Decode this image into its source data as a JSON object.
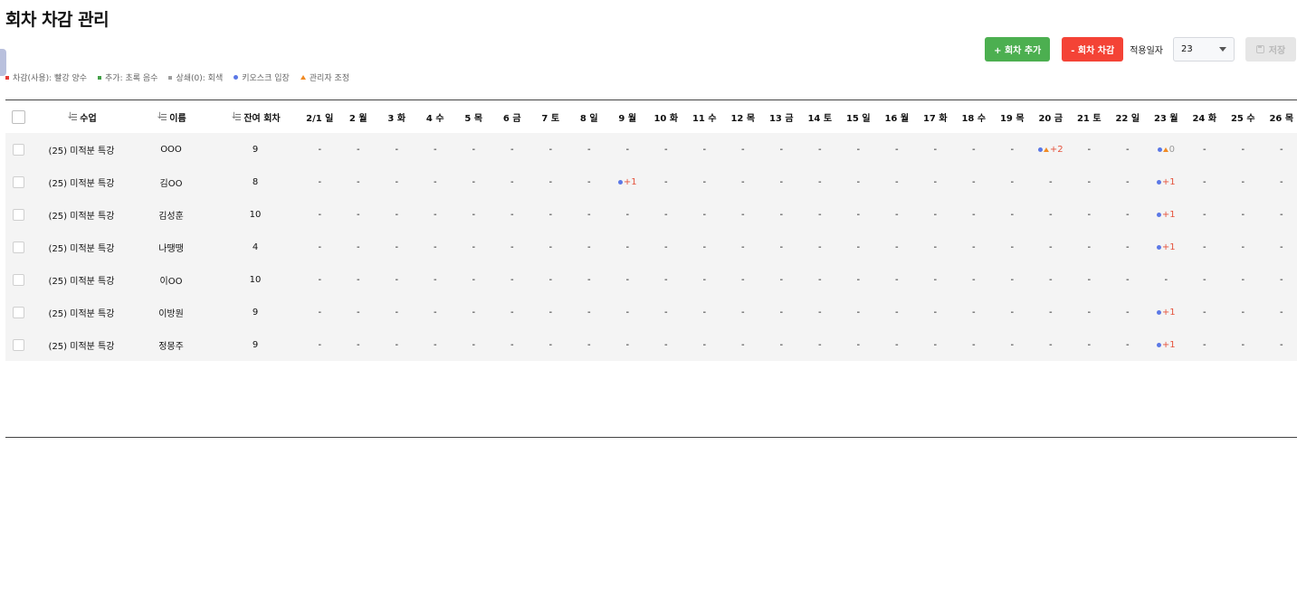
{
  "page": {
    "title": "회차 차감 관리"
  },
  "toolbar": {
    "add_label": "+ 회차 추가",
    "deduct_label": "- 회차 차감",
    "apply_date_label": "적용일자",
    "apply_date_value": "23",
    "save_label": "저장"
  },
  "legend": [
    {
      "label": "차감(사용): 빨강 양수",
      "shape": "square",
      "color": "#e53935"
    },
    {
      "label": "추가: 초록 음수",
      "shape": "square",
      "color": "#43a047"
    },
    {
      "label": "상쇄(0): 회색",
      "shape": "square",
      "color": "#9e9e9e"
    },
    {
      "label": "키오스크 입장",
      "shape": "dot",
      "color": "#5b78e6"
    },
    {
      "label": "관리자 조정",
      "shape": "triangle",
      "color": "#f08a24"
    }
  ],
  "table": {
    "headers": {
      "class": "수업",
      "name": "이름",
      "remaining": "잔여 회차"
    },
    "days": [
      "2/1 일",
      "2 월",
      "3 화",
      "4 수",
      "5 목",
      "6 금",
      "7 토",
      "8 일",
      "9 월",
      "10 화",
      "11 수",
      "12 목",
      "13 금",
      "14 토",
      "15 일",
      "16 월",
      "17 화",
      "18 수",
      "19 목",
      "20 금",
      "21 토",
      "22 일",
      "23 월",
      "24 화",
      "25 수",
      "26 목"
    ],
    "rows": [
      {
        "class": "(25) 미적분 특강",
        "name": "OOO",
        "remaining": "9",
        "marks": {
          "19": {
            "kiosk": true,
            "admin": true,
            "value": "+2",
            "tone": "plus"
          },
          "22": {
            "kiosk": true,
            "admin": true,
            "value": "0",
            "tone": "zero"
          }
        }
      },
      {
        "class": "(25) 미적분 특강",
        "name": "김OO",
        "remaining": "8",
        "marks": {
          "8": {
            "kiosk": true,
            "admin": false,
            "value": "+1",
            "tone": "plus"
          },
          "22": {
            "kiosk": true,
            "admin": false,
            "value": "+1",
            "tone": "plus"
          }
        }
      },
      {
        "class": "(25) 미적분 특강",
        "name": "김성훈",
        "remaining": "10",
        "marks": {
          "22": {
            "kiosk": true,
            "admin": false,
            "value": "+1",
            "tone": "plus"
          }
        }
      },
      {
        "class": "(25) 미적분 특강",
        "name": "나땡땡",
        "remaining": "4",
        "marks": {
          "22": {
            "kiosk": true,
            "admin": false,
            "value": "+1",
            "tone": "plus"
          }
        }
      },
      {
        "class": "(25) 미적분 특강",
        "name": "이OO",
        "remaining": "10",
        "marks": {}
      },
      {
        "class": "(25) 미적분 특강",
        "name": "이방원",
        "remaining": "9",
        "marks": {
          "22": {
            "kiosk": true,
            "admin": false,
            "value": "+1",
            "tone": "plus"
          }
        }
      },
      {
        "class": "(25) 미적분 특강",
        "name": "정몽주",
        "remaining": "9",
        "marks": {
          "22": {
            "kiosk": true,
            "admin": false,
            "value": "+1",
            "tone": "plus"
          }
        }
      }
    ],
    "empty_cell": "-"
  }
}
